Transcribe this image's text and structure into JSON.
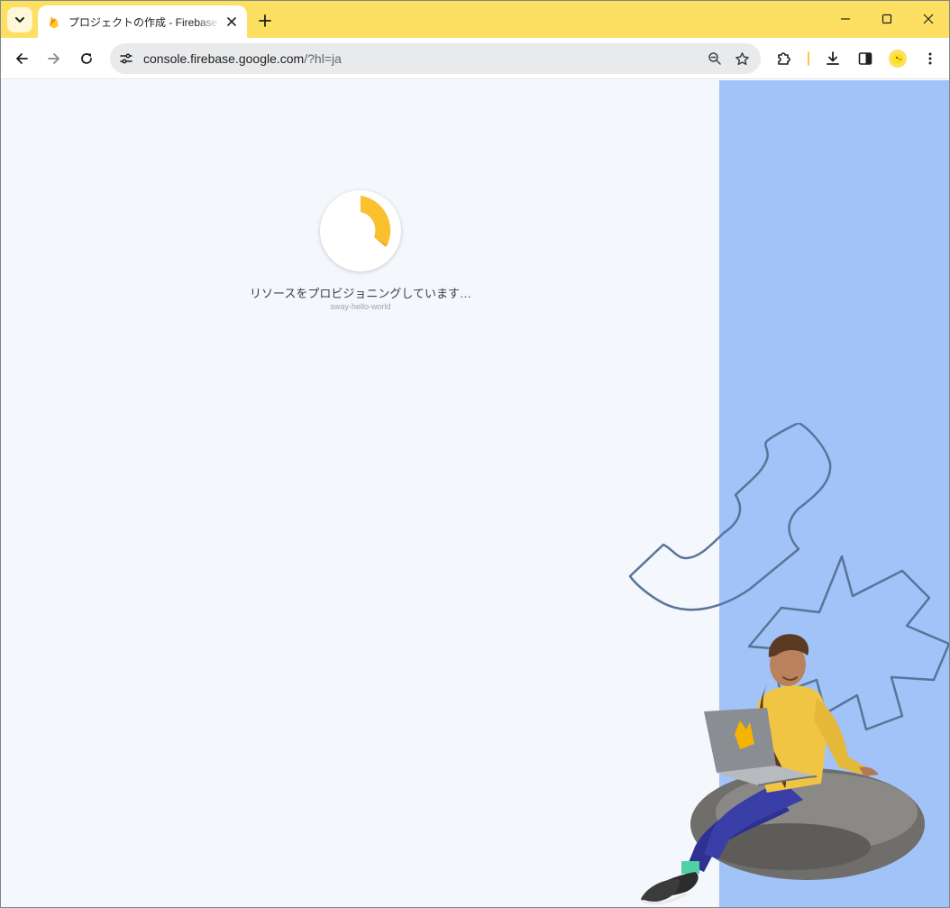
{
  "browser": {
    "tab": {
      "title": "プロジェクトの作成 - Firebase コンソール",
      "favicon": "firebase-flame-icon"
    },
    "address_bar": {
      "host": "console.firebase.google.com",
      "path": "/?hl=ja"
    },
    "icons": {
      "tab_search": "chevron-down-icon",
      "new_tab": "plus-icon",
      "minimize": "minimize-icon",
      "maximize": "maximize-icon",
      "close": "close-icon",
      "back": "back-arrow-icon",
      "forward": "forward-arrow-icon",
      "reload": "reload-icon",
      "site_info": "tune-icon",
      "zoom": "zoom-out-icon",
      "bookmark": "star-icon",
      "extensions": "puzzle-icon",
      "downloads": "download-icon",
      "side_panel": "side-panel-icon",
      "profile": "profile-avatar-icon",
      "menu": "kebab-menu-icon"
    },
    "colors": {
      "frame": "#fddf62",
      "accent": "#f7c948"
    }
  },
  "page": {
    "loading_text": "リソースをプロビジョニングしています…",
    "project_name": "sway-hello-world",
    "colors": {
      "background": "#f4f7fc",
      "panel": "#a1c3f8",
      "spinner": "#fbc02d"
    }
  }
}
